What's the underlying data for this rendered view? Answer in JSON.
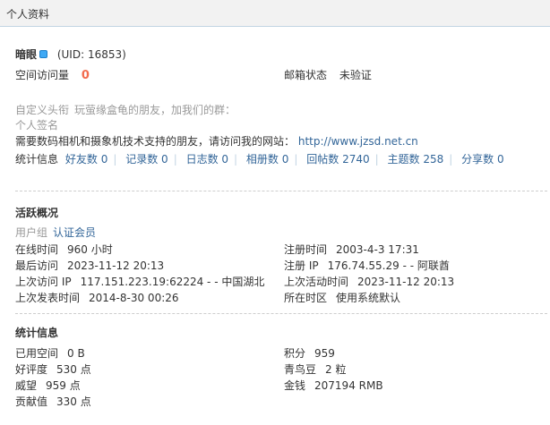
{
  "header": {
    "title": "个人资料"
  },
  "profile": {
    "username": "暗眼",
    "uid": "(UID: 16853)",
    "space_visits_label": "空间访问量",
    "space_visits_value": "0",
    "email_status_label": "邮箱状态",
    "email_status_value": "未验证",
    "custom_title_label": "自定义头衔",
    "custom_title_value": "玩萤缘盒龟的朋友，加我们的群：",
    "signature_label": "个人签名",
    "promo_text": "需要数码相机和摄象机技术支持的朋友，请访问我的网站：",
    "promo_url": "http://www.jzsd.net.cn"
  },
  "stats_bar": {
    "label": "统计信息",
    "items": [
      {
        "label": "好友数",
        "value": "0"
      },
      {
        "label": "记录数",
        "value": "0"
      },
      {
        "label": "日志数",
        "value": "0"
      },
      {
        "label": "相册数",
        "value": "0"
      },
      {
        "label": "回帖数",
        "value": "2740"
      },
      {
        "label": "主题数",
        "value": "258"
      },
      {
        "label": "分享数",
        "value": "0"
      }
    ]
  },
  "activity": {
    "title": "活跃概况",
    "usergroup_label": "用户组",
    "usergroup_value": "认证会员",
    "online_time_label": "在线时间",
    "online_time_value": "960 小时",
    "register_time_label": "注册时间",
    "register_time_value": "2003-4-3 17:31",
    "last_visit_label": "最后访问",
    "last_visit_value": "2023-11-12 20:13",
    "register_ip_label": "注册 IP",
    "register_ip_value": "176.74.55.29 - - 阿联酋",
    "last_visit_ip_label": "上次访问 IP",
    "last_visit_ip_value": "117.151.223.19:62224 - - 中国湖北",
    "last_active_label": "上次活动时间",
    "last_active_value": "2023-11-12 20:13",
    "last_post_label": "上次发表时间",
    "last_post_value": "2014-8-30 00:26",
    "timezone_label": "所在时区",
    "timezone_value": "使用系统默认"
  },
  "statistics": {
    "title": "统计信息",
    "used_space_label": "已用空间",
    "used_space_value": "0 B",
    "points_label": "积分",
    "points_value": "959",
    "rating_label": "好评度",
    "rating_value": "530 点",
    "qingniao_label": "青鸟豆",
    "qingniao_value": "2 粒",
    "prestige_label": "威望",
    "prestige_value": "959 点",
    "money_label": "金钱",
    "money_value": "207194 RMB",
    "contribution_label": "贡献值",
    "contribution_value": "330 点"
  }
}
